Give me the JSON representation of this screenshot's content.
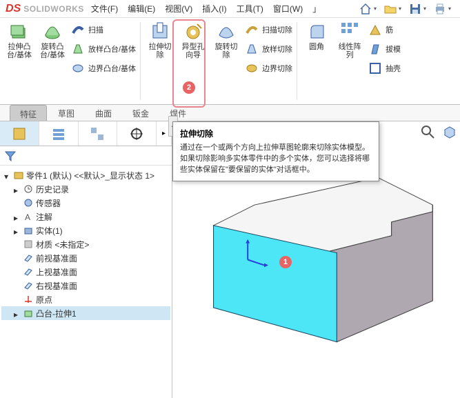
{
  "app": {
    "brand_ds": "DS",
    "brand_name": "SOLIDWORKS"
  },
  "menu": {
    "items": [
      "文件(F)",
      "编辑(E)",
      "视图(V)",
      "插入(I)",
      "工具(T)",
      "窗口(W)"
    ]
  },
  "qat": {
    "home": "home-icon",
    "open_folder": "open-icon",
    "save": "save-icon",
    "print": "print-icon"
  },
  "ribbon": {
    "group1": {
      "boss_extrude": "拉伸凸\n台/基体",
      "revolved_boss": "旋转凸\n台/基体",
      "swept": "扫描",
      "lofted": "放样凸台/基体",
      "boundary": "边界凸台/基体"
    },
    "group2": {
      "extrude_cut": "拉伸切\n除",
      "hole_wizard": "异型孔\n向导",
      "revolved_cut": "旋转切\n除",
      "swept_cut": "扫描切除",
      "lofted_cut": "放样切除",
      "boundary_cut": "边界切除"
    },
    "group3": {
      "fillet": "圆角",
      "pattern": "线性阵\n列",
      "rib": "筋",
      "draft": "拔模",
      "shell": "抽壳"
    }
  },
  "ribbon_tabs": [
    "特征",
    "草图",
    "曲面",
    "钣金",
    "焊件"
  ],
  "badges": {
    "one": "1",
    "two": "2"
  },
  "tooltip": {
    "title": "拉伸切除",
    "body": "通过在一个或两个方向上拉伸草图轮廓来切除实体模型。\n如果切除影响多实体零件中的多个实体，您可以选择将哪些实体保留在\"要保留的实体\"对话框中。"
  },
  "tree": {
    "root": "零件1 (默认) <<默认>_显示状态 1>",
    "history": "历史记录",
    "sensors": "传感器",
    "annotations": "注解",
    "solid_bodies": "实体(1)",
    "material": "材质 <未指定>",
    "front_plane": "前视基准面",
    "top_plane": "上视基准面",
    "right_plane": "右视基准面",
    "origin": "原点",
    "feature_extrude": "凸台-拉伸1"
  },
  "collapse_glyph": "◂"
}
